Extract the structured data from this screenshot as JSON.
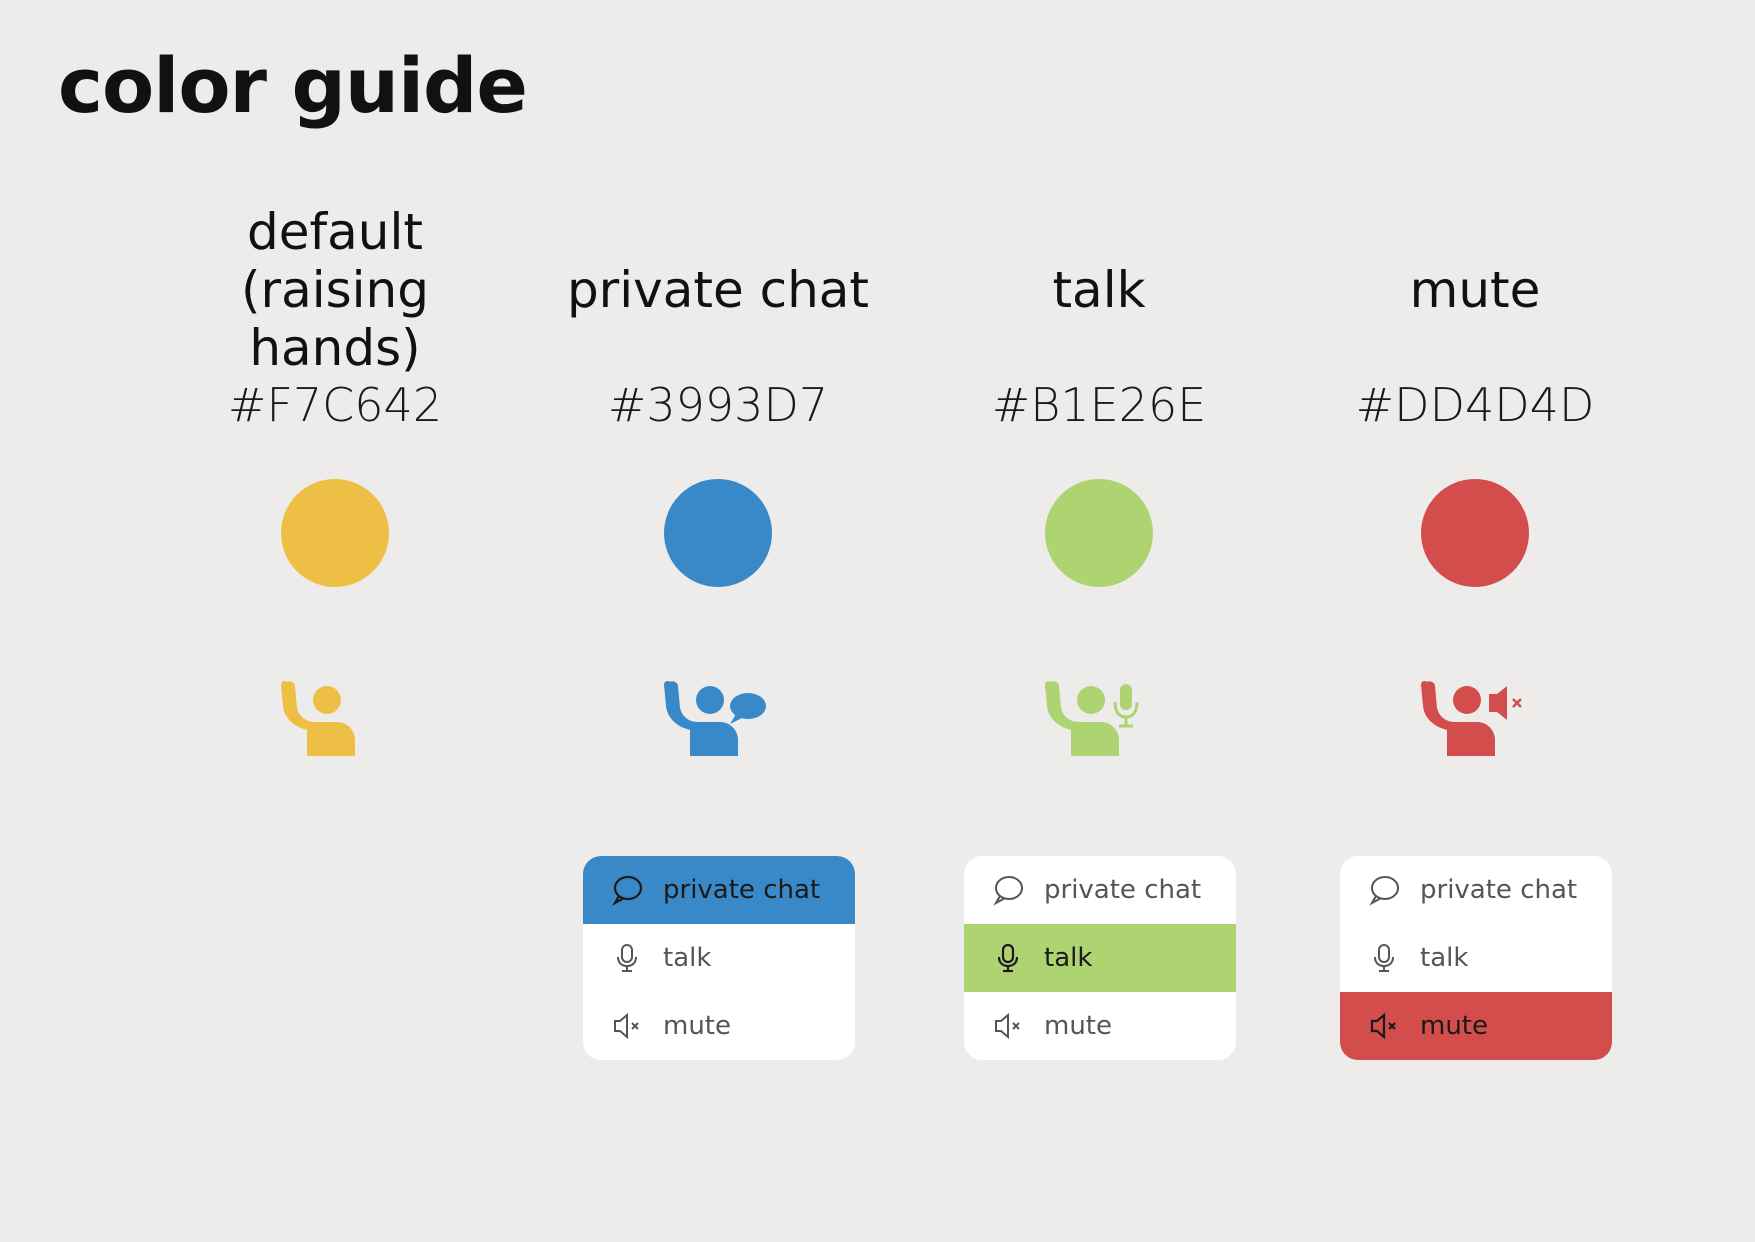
{
  "title": "color guide",
  "states": [
    {
      "key": "default",
      "name": "default\n(raising hands)",
      "hex": "#F7C642",
      "color": "#EDBF45",
      "icon": "raise-hand-icon",
      "menu": null
    },
    {
      "key": "private",
      "name": "private chat",
      "hex": "#3993D7",
      "color": "#3989C8",
      "icon": "private-chat-person-icon",
      "menu": {
        "active": 0
      }
    },
    {
      "key": "talk",
      "name": "talk",
      "hex": "#B1E26E",
      "color": "#AED472",
      "icon": "talk-person-icon",
      "menu": {
        "active": 1
      }
    },
    {
      "key": "mute",
      "name": "mute",
      "hex": "#DD4D4D",
      "color": "#D34D4D",
      "icon": "mute-person-icon",
      "menu": {
        "active": 2
      }
    }
  ],
  "menu_items": [
    {
      "label": "private chat",
      "icon": "speech-bubble-icon"
    },
    {
      "label": "talk",
      "icon": "microphone-icon"
    },
    {
      "label": "mute",
      "icon": "speaker-mute-icon"
    }
  ]
}
